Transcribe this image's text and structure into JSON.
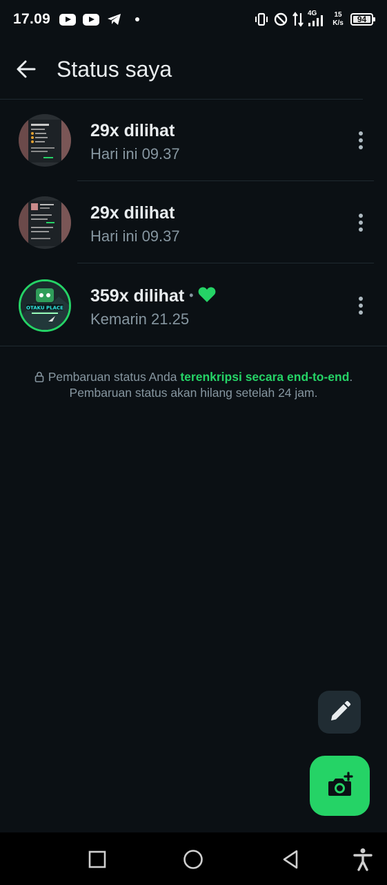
{
  "status_bar": {
    "time": "17.09",
    "network": "4G",
    "speed_value": "15",
    "speed_unit": "K/s",
    "battery": "94"
  },
  "header": {
    "title": "Status saya"
  },
  "statuses": [
    {
      "views": "29x dilihat",
      "time": "Hari ini 09.37",
      "reaction": ""
    },
    {
      "views": "29x dilihat",
      "time": "Hari ini 09.37",
      "reaction": ""
    },
    {
      "views": "359x dilihat",
      "time": "Kemarin 21.25",
      "reaction": "heart-icon"
    }
  ],
  "notice": {
    "line1_prefix": "Pembaruan status Anda ",
    "line1_link": "terenkripsi secara end-to-end",
    "line1_suffix": ".",
    "line2": "Pembaruan status akan hilang setelah 24 jam."
  },
  "thumbnail_text": {
    "logo_text": "OTAKU PLACE"
  },
  "colors": {
    "background": "#0b1014",
    "accent": "#25d366",
    "secondary_text": "#8696a0",
    "fab_secondary": "#202c33"
  },
  "icons": {
    "back": "arrow-left-icon",
    "menu": "more-vert-icon",
    "lock": "lock-icon",
    "pen": "pencil-icon",
    "camera": "camera-plus-icon",
    "nav": [
      "recents-icon",
      "home-icon",
      "back-triangle-icon",
      "accessibility-icon"
    ]
  }
}
